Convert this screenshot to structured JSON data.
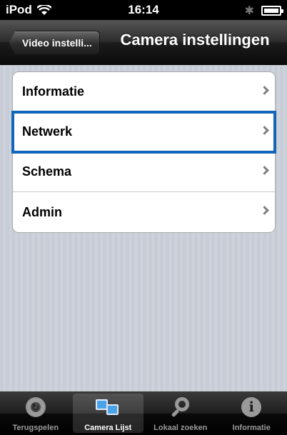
{
  "status_bar": {
    "device": "iPod",
    "wifi_icon": "wifi-icon",
    "time": "16:14",
    "bluetooth_icon": "bluetooth-icon",
    "battery_icon": "battery-icon"
  },
  "nav": {
    "back_label": "Video instelli...",
    "title": "Camera instellingen"
  },
  "menu": {
    "items": [
      {
        "label": "Informatie",
        "selected": false
      },
      {
        "label": "Netwerk",
        "selected": true
      },
      {
        "label": "Schema",
        "selected": false
      },
      {
        "label": "Admin",
        "selected": false
      }
    ]
  },
  "tabbar": {
    "tabs": [
      {
        "label": "Terugspelen",
        "icon": "replay-icon",
        "active": false
      },
      {
        "label": "Camera Lijst",
        "icon": "camera-list-icon",
        "active": true
      },
      {
        "label": "Lokaal zoeken",
        "icon": "search-icon",
        "active": false
      },
      {
        "label": "Informatie",
        "icon": "info-icon",
        "active": false
      }
    ]
  },
  "colors": {
    "selection_outline": "#1266b8",
    "content_background": "#c7ccd6",
    "camera_icon_blue": "#4aa2e8"
  }
}
